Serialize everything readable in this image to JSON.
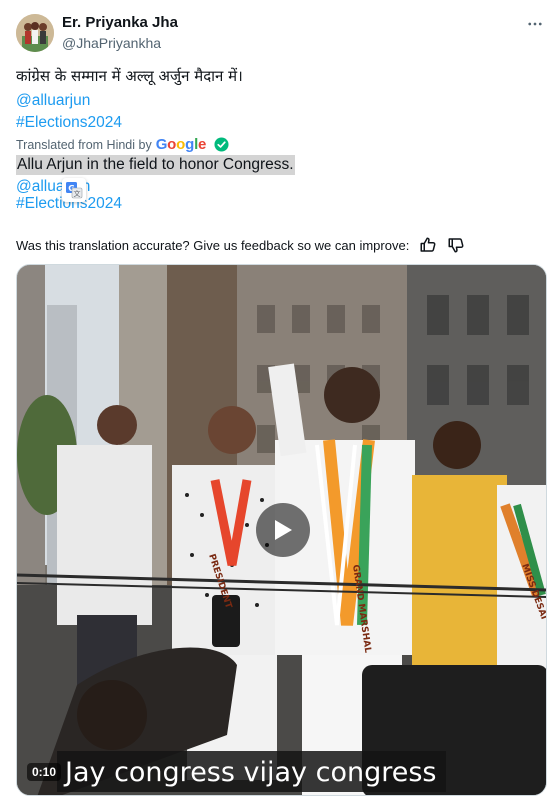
{
  "author": {
    "name": "Er. Priyanka Jha",
    "handle": "@JhaPriyankha"
  },
  "tweet": {
    "text_original": "कांग्रेस के सम्मान में अल्लू अर्जुन मैदान में।",
    "mention": "@alluarjun",
    "hashtag": "#Elections2024"
  },
  "translation": {
    "label": "Translated from Hindi by",
    "provider": [
      "G",
      "o",
      "o",
      "g",
      "l",
      "e"
    ],
    "text": "Allu Arjun in the field to honor Congress.",
    "mention": "@alluarjun",
    "hashtag": "#Elections2024"
  },
  "feedback": {
    "prompt": "Was this translation accurate? Give us feedback so we can improve:"
  },
  "video": {
    "duration": "0:10",
    "caption": "Jay congress vijay congress",
    "sashes": [
      "PRESIDENT",
      "GRAND MARSHAL",
      "MISS DESAI"
    ]
  },
  "icons": {
    "more": "more-dots-icon",
    "verified": "verified-check-icon",
    "translate": "translate-icon",
    "thumbs_up": "thumbs-up-icon",
    "thumbs_down": "thumbs-down-icon",
    "play": "play-icon"
  },
  "colors": {
    "link": "#1d9bf0",
    "secondary_text": "#536471",
    "verified_green": "#00ba7c"
  }
}
